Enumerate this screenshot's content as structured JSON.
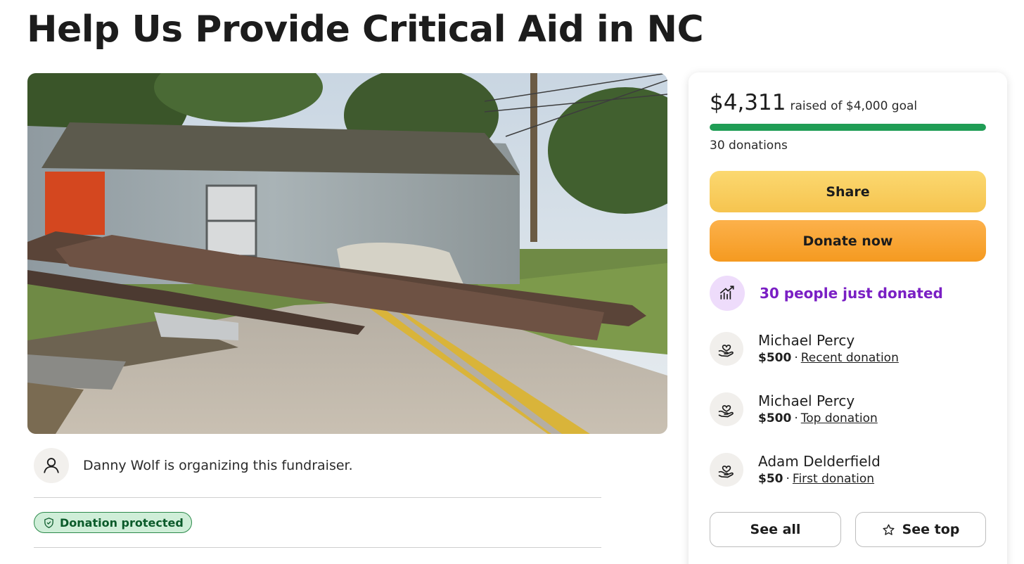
{
  "page": {
    "title": "Help Us Provide Critical Aid in NC"
  },
  "hero_image": {
    "alt": "Flood-damaged mobile home with steel beam across road"
  },
  "organizer": {
    "text": "Danny Wolf is organizing this fundraiser.",
    "icon": "person-icon"
  },
  "badge": {
    "label": "Donation protected",
    "icon": "shield-check-icon"
  },
  "summary": {
    "raised": "$4,311",
    "goal_text": "raised of $4,000 goal",
    "progress_fraction": 1.0,
    "donations_count": "30 donations",
    "progress_color": "#1f9d55"
  },
  "buttons": {
    "share": "Share",
    "donate": "Donate now",
    "see_all": "See all",
    "see_top": "See top",
    "see_top_icon": "star-icon"
  },
  "activity": {
    "text": "30 people just donated",
    "icon": "trending-up-icon",
    "color": "#7a1fc4"
  },
  "donors": [
    {
      "name": "Michael Percy",
      "amount": "$500",
      "sep": "·",
      "tag": "Recent donation",
      "icon": "heart-hand-icon"
    },
    {
      "name": "Michael Percy",
      "amount": "$500",
      "sep": "·",
      "tag": "Top donation",
      "icon": "heart-hand-icon"
    },
    {
      "name": "Adam Delderfield",
      "amount": "$50",
      "sep": "·",
      "tag": "First donation",
      "icon": "heart-hand-icon"
    }
  ],
  "colors": {
    "share_button": "#f6c44f",
    "donate_button": "#f59a20",
    "badge_bg": "#cfeed8",
    "badge_text": "#0b5a2a"
  }
}
